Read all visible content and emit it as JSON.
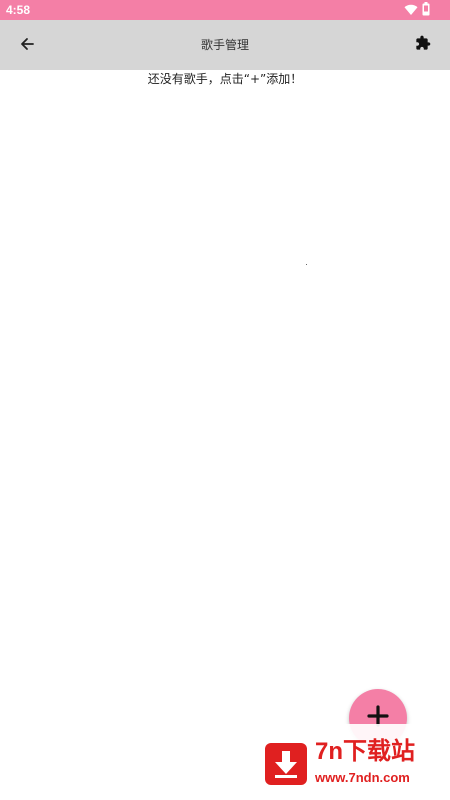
{
  "status_bar": {
    "time": "4:58",
    "icons": [
      "wifi-icon",
      "battery-icon"
    ],
    "color": "#f47fa6"
  },
  "app_bar": {
    "title": "歌手管理",
    "left_icon": "arrow-back-icon",
    "right_icon": "puzzle-icon",
    "color": "#d6d6d6"
  },
  "content": {
    "empty_message": "还没有歌手，点击“+”添加！"
  },
  "fab": {
    "icon": "plus-icon",
    "color": "#f47fa6"
  },
  "watermark": {
    "name": "7n下载站",
    "url": "www.7ndn.com",
    "color": "#e02020"
  }
}
